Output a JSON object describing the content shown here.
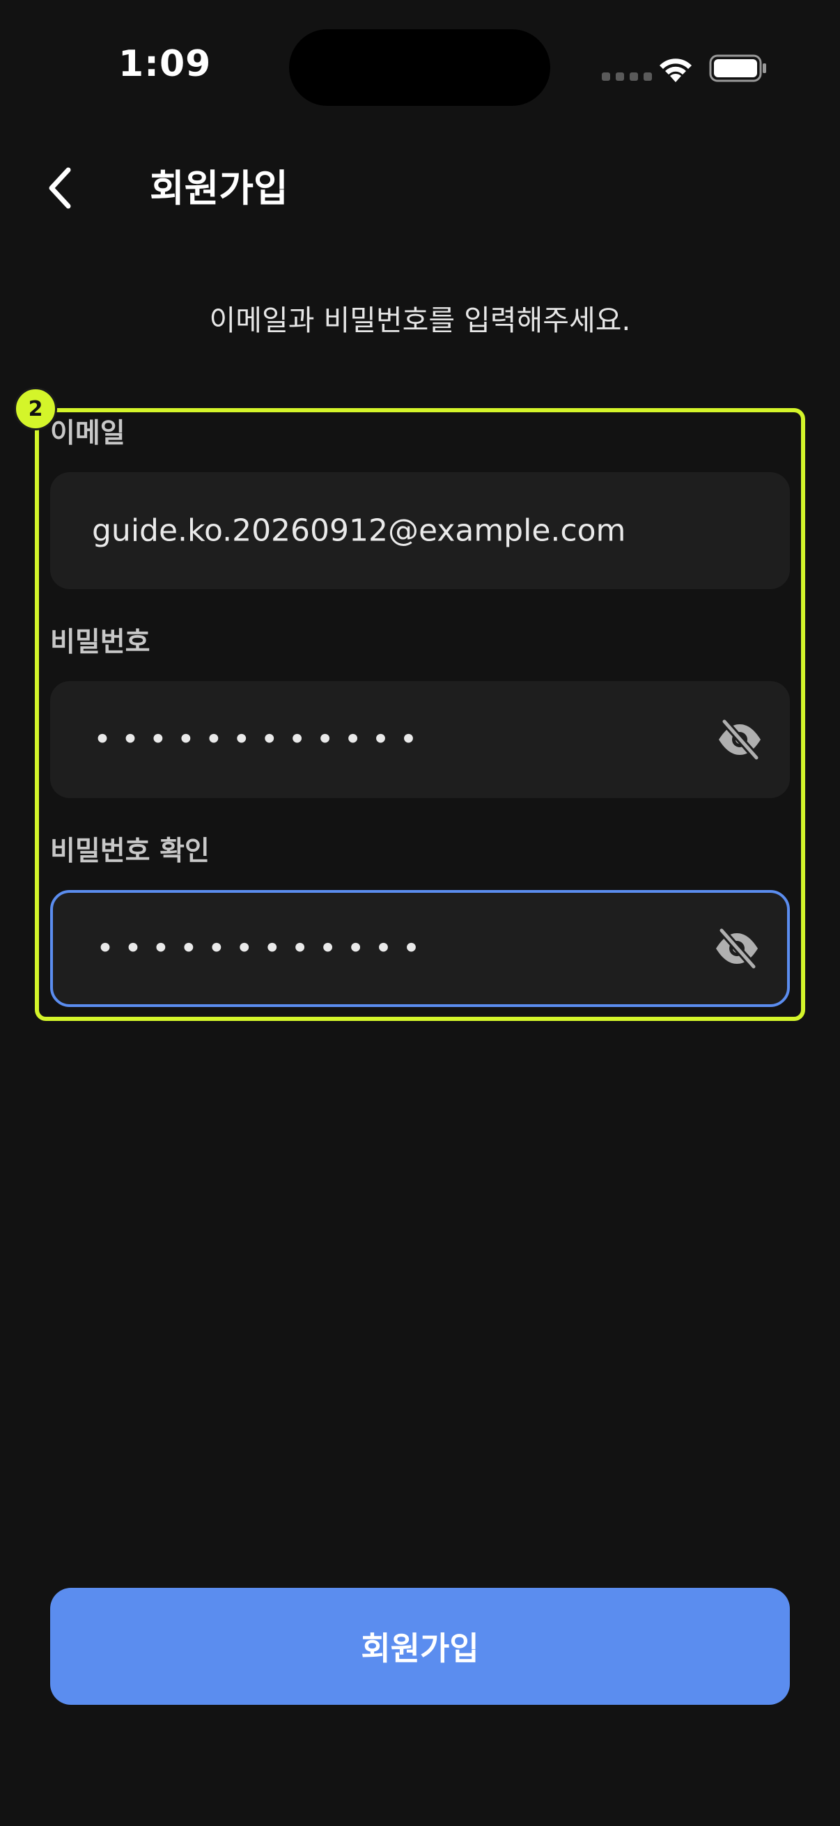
{
  "status_bar": {
    "time": "1:09"
  },
  "header": {
    "title": "회원가입",
    "back_icon": "chevron-left-icon"
  },
  "subtitle": "이메일과 비밀번호를 입력해주세요.",
  "highlight": {
    "badge": "2",
    "color": "#d4f52a"
  },
  "form": {
    "email": {
      "label": "이메일",
      "value": "guide.ko.20260912@example.com"
    },
    "password": {
      "label": "비밀번호",
      "value": "••••••••••••",
      "toggle_icon": "eye-off-icon"
    },
    "password_confirm": {
      "label": "비밀번호 확인",
      "value": "••••••••••••",
      "toggle_icon": "eye-off-icon"
    }
  },
  "submit": {
    "label": "회원가입"
  },
  "colors": {
    "background": "#121212",
    "field_bg": "#1e1e1e",
    "accent": "#5b8def"
  }
}
